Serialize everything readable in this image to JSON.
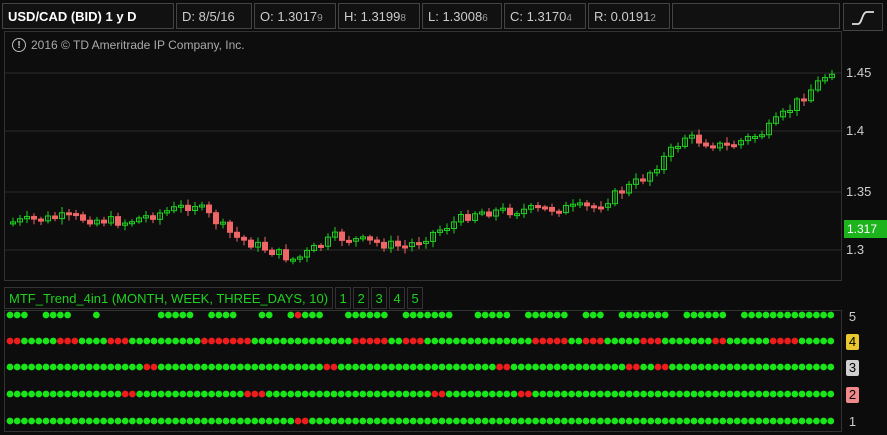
{
  "header": {
    "symbol": "USD/CAD (BID) 1 y D",
    "date": "D: 8/5/16",
    "open_main": "O: 1.3017",
    "open_sub": "9",
    "high_main": "H: 1.3199",
    "high_sub": "8",
    "low_main": "L: 1.3008",
    "low_sub": "6",
    "close_main": "C: 1.3170",
    "close_sub": "4",
    "range_main": "R: 0.0191",
    "range_sub": "2"
  },
  "copyright": "2016 © TD Ameritrade IP Company, Inc.",
  "price_axis": {
    "ticks": [
      "1.45",
      "1.4",
      "1.35",
      "1.3"
    ],
    "last_price": "1.317"
  },
  "study": {
    "title": "MTF_Trend_4in1 (MONTH, WEEK, THREE_DAYS, 10)",
    "plot_buttons": [
      "1",
      "2",
      "3",
      "4",
      "5"
    ]
  },
  "lower_axis": {
    "labels": [
      "5",
      "4",
      "3",
      "2",
      "1"
    ],
    "colors": {
      "4": "#e8c82e",
      "3": "#cfcfcf",
      "2": "#f08a8a"
    }
  },
  "colors": {
    "up": "#1fd11f",
    "down": "#f06666",
    "dot_up": "#19e619",
    "dot_down": "#ee1c1c",
    "grid": "#2a2a2a",
    "panel_border": "#333333"
  },
  "icons": {
    "style_button": "line-chart-style-icon",
    "info": "info-circle-icon"
  }
}
